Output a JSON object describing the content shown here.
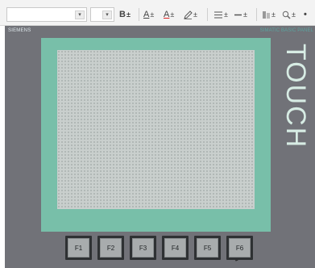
{
  "toolbar": {
    "bold_label": "B",
    "font_color_label": "A",
    "fill_color_label": "A",
    "dropdown_glyph": "±",
    "combo_arrow": "▾"
  },
  "panel": {
    "brand": "SIEMENS",
    "model": "SIMATIC BASIC PANEL",
    "touch_label": "TOUCH"
  },
  "function_keys": [
    "F1",
    "F2",
    "F3",
    "F4",
    "F5",
    "F6"
  ],
  "colors": {
    "panel_body": "#717278",
    "bezel": "#78bfa9",
    "screen": "#c9cfcd",
    "touch_text": "#d7ece4"
  }
}
